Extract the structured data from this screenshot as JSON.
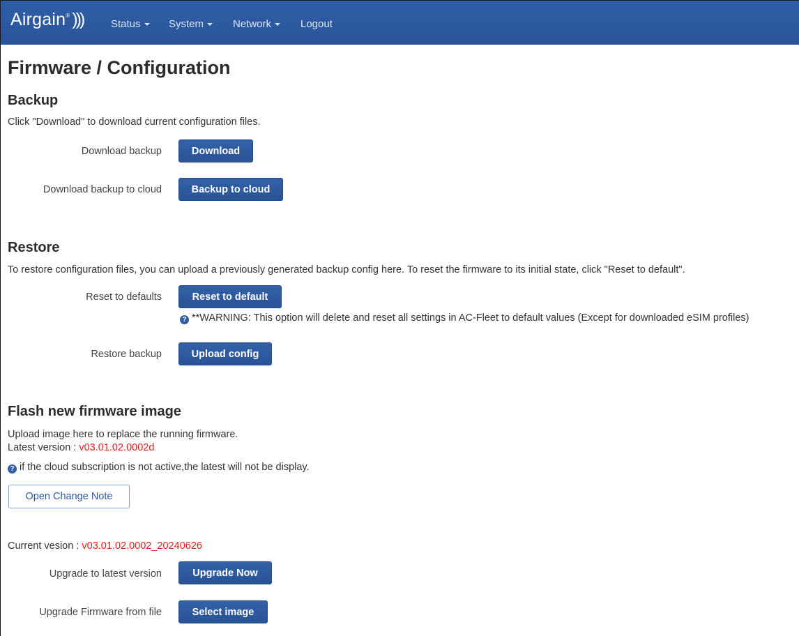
{
  "navbar": {
    "brand": "Airgain",
    "brand_waves": ")))",
    "brand_tm": "®",
    "items": [
      {
        "label": "Status"
      },
      {
        "label": "System"
      },
      {
        "label": "Network"
      },
      {
        "label": "Logout"
      }
    ]
  },
  "page_title": "Firmware / Configuration",
  "backup": {
    "heading": "Backup",
    "description": "Click \"Download\" to download current configuration files.",
    "download_label": "Download backup",
    "download_button": "Download",
    "cloud_label": "Download backup to cloud",
    "cloud_button": "Backup to cloud"
  },
  "restore": {
    "heading": "Restore",
    "description": "To restore configuration files, you can upload a previously generated backup config here. To reset the firmware to its initial state, click \"Reset to default\".",
    "reset_label": "Reset to defaults",
    "reset_button": "Reset to default",
    "warning": "**WARNING: This option will delete and reset all settings in AC-Fleet to default values (Except for downloaded eSIM profiles)",
    "restore_label": "Restore backup",
    "upload_button": "Upload config"
  },
  "flash": {
    "heading": "Flash new firmware image",
    "description": "Upload image here to replace the running firmware.",
    "latest_prefix": "Latest version : ",
    "latest_version": "v03.01.02.0002d",
    "cloud_note": "if the cloud subscription is not active,the latest will not be display.",
    "change_note_button": "Open Change Note",
    "current_prefix": "Current vesion : ",
    "current_version": "v03.01.02.0002_20240626",
    "upgrade_label": "Upgrade to latest version",
    "upgrade_button": "Upgrade Now",
    "file_label": "Upgrade Firmware from file",
    "select_button": "Select image"
  },
  "icons": {
    "help": "question-circle-icon",
    "dropdown": "caret-down-icon"
  },
  "colors": {
    "navbar": "#2c5aa0",
    "button": "#2d5a9e",
    "version_red": "#e0201b"
  }
}
